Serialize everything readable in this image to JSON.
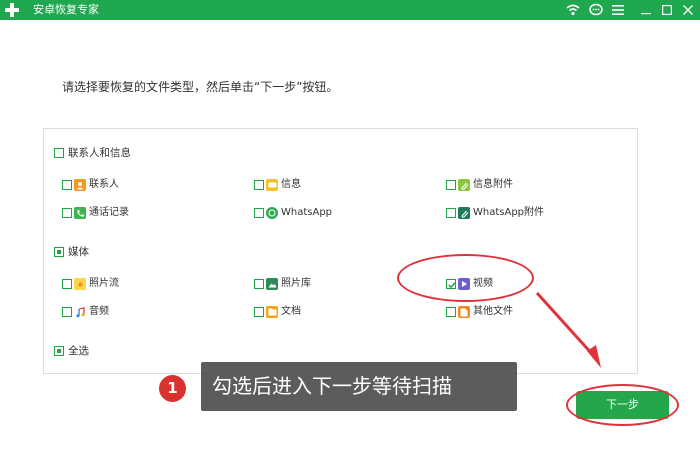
{
  "window": {
    "title": "安卓恢复专家"
  },
  "instruction": "请选择要恢复的文件类型，然后单击“下一步”按钮。",
  "groups": {
    "contacts": {
      "label": "联系人和信息",
      "items": [
        {
          "label": "联系人",
          "icon": "contact-icon",
          "checked": false
        },
        {
          "label": "信息",
          "icon": "message-icon",
          "checked": false
        },
        {
          "label": "信息附件",
          "icon": "attachment-icon",
          "checked": false
        },
        {
          "label": "通话记录",
          "icon": "phone-icon",
          "checked": false
        },
        {
          "label": "WhatsApp",
          "icon": "whatsapp-icon",
          "checked": false
        },
        {
          "label": "WhatsApp附件",
          "icon": "whatsapp-attachment-icon",
          "checked": false
        }
      ]
    },
    "media": {
      "label": "媒体",
      "items": [
        {
          "label": "照片流",
          "icon": "photo-stream-icon",
          "checked": false
        },
        {
          "label": "照片库",
          "icon": "photo-library-icon",
          "checked": false
        },
        {
          "label": "视频",
          "icon": "video-icon",
          "checked": true
        },
        {
          "label": "音频",
          "icon": "audio-icon",
          "checked": false
        },
        {
          "label": "文档",
          "icon": "document-icon",
          "checked": false
        },
        {
          "label": "其他文件",
          "icon": "other-file-icon",
          "checked": false
        }
      ]
    },
    "select_all": {
      "label": "全选"
    }
  },
  "next_button": "下一步",
  "annotation": {
    "step_number": "1",
    "tip": "勾选后进入下一步等待扫描"
  },
  "colors": {
    "brand_green": "#1fa84f",
    "checkbox_green": "#21a54c",
    "annotation_red": "#e0323a"
  }
}
